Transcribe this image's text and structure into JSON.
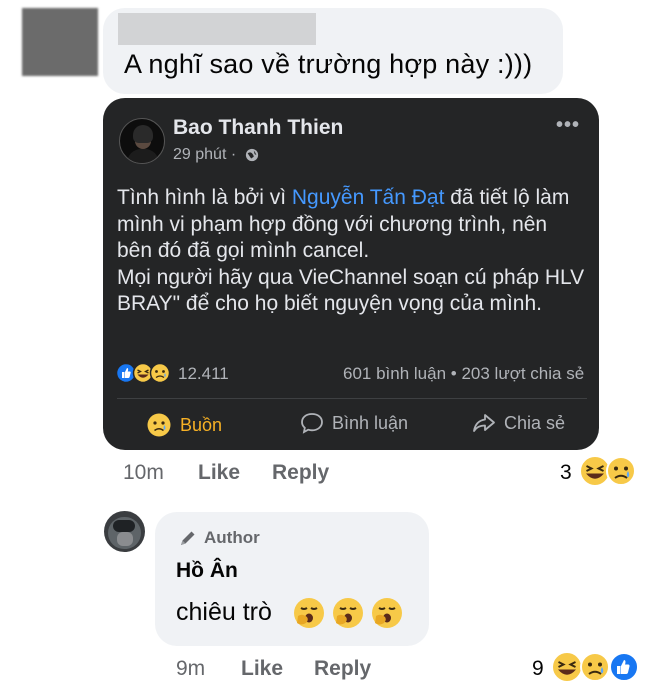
{
  "comment1": {
    "text": "A nghĩ sao về trường hợp này :)))",
    "meta": {
      "time": "10m",
      "like": "Like",
      "reply": "Reply",
      "reaction_count": "3"
    }
  },
  "shared_post": {
    "author": "Bao Thanh Thien",
    "time": "29 phút",
    "time_sep": "·",
    "more": "•••",
    "body": {
      "part1": "Tình hình là bởi vì ",
      "mention": "Nguyễn Tấn Đạt",
      "part2": " đã tiết lộ làm mình vi phạm hợp đồng với chương trình, nên bên đó đã gọi mình cancel.",
      "part3": "Mọi người hãy qua VieChannel soạn cú pháp HLV BRAY\" để cho họ biết nguyện vọng của mình."
    },
    "reaction_count": "12.411",
    "comments": "601 bình luận",
    "stats_sep": "•",
    "shares": "203 lượt chia sẻ",
    "actions": {
      "sad": "Buồn",
      "comment": "Bình luận",
      "share": "Chia sẻ"
    },
    "colors": {
      "card_bg": "#242526",
      "mention": "#4599ff",
      "sad_accent": "#f7b125"
    }
  },
  "reply": {
    "badge": "Author",
    "name": "Hồ Ân",
    "text": "chiêu trò",
    "emoji_icons": [
      "yawn-emoji-icon",
      "yawn-emoji-icon",
      "yawn-emoji-icon"
    ],
    "meta": {
      "time": "9m",
      "like": "Like",
      "reply": "Reply",
      "reaction_count": "9"
    }
  }
}
